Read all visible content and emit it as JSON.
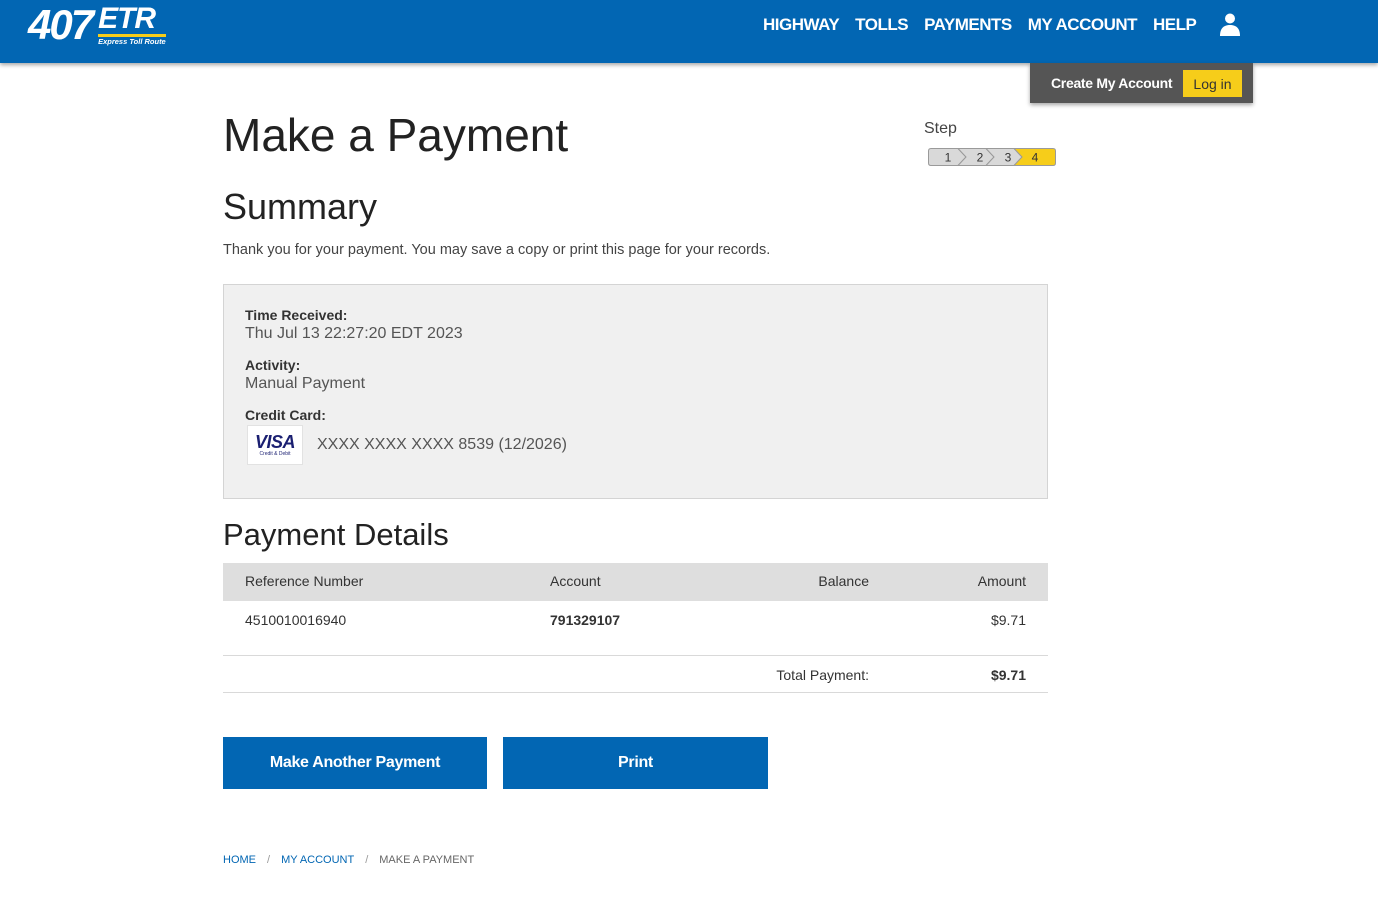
{
  "header": {
    "logo": {
      "number": "407",
      "letters": "ETR",
      "tagline": "Express Toll Route"
    },
    "nav": [
      "HIGHWAY",
      "TOLLS",
      "PAYMENTS",
      "MY ACCOUNT",
      "HELP"
    ],
    "account_menu": {
      "create": "Create My Account",
      "login": "Log in"
    }
  },
  "page": {
    "title": "Make a Payment",
    "step_label": "Step",
    "steps": [
      "1",
      "2",
      "3",
      "4"
    ],
    "current_step": 4
  },
  "summary": {
    "title": "Summary",
    "message": "Thank you for your payment. You may save a copy or print this page for your records.",
    "time_label": "Time Received:",
    "time_value": "Thu Jul 13 22:27:20 EDT 2023",
    "activity_label": "Activity:",
    "activity_value": "Manual Payment",
    "card_label": "Credit Card:",
    "card_brand": "VISA",
    "card_brand_sub": "Credit & Debit",
    "card_number": "XXXX XXXX XXXX 8539 (12/2026)"
  },
  "details": {
    "title": "Payment Details",
    "columns": [
      "Reference Number",
      "Account",
      "Balance",
      "Amount"
    ],
    "rows": [
      {
        "reference": "4510010016940",
        "account": "791329107",
        "balance": "",
        "amount": "$9.71"
      }
    ],
    "total_label": "Total Payment:",
    "total_value": "$9.71"
  },
  "buttons": {
    "another": "Make Another Payment",
    "print": "Print"
  },
  "breadcrumb": [
    "HOME",
    "MY ACCOUNT",
    "MAKE A PAYMENT"
  ],
  "colors": {
    "brand_blue": "#0266b3",
    "accent_yellow": "#f6cd1a",
    "account_bar": "#555555"
  }
}
